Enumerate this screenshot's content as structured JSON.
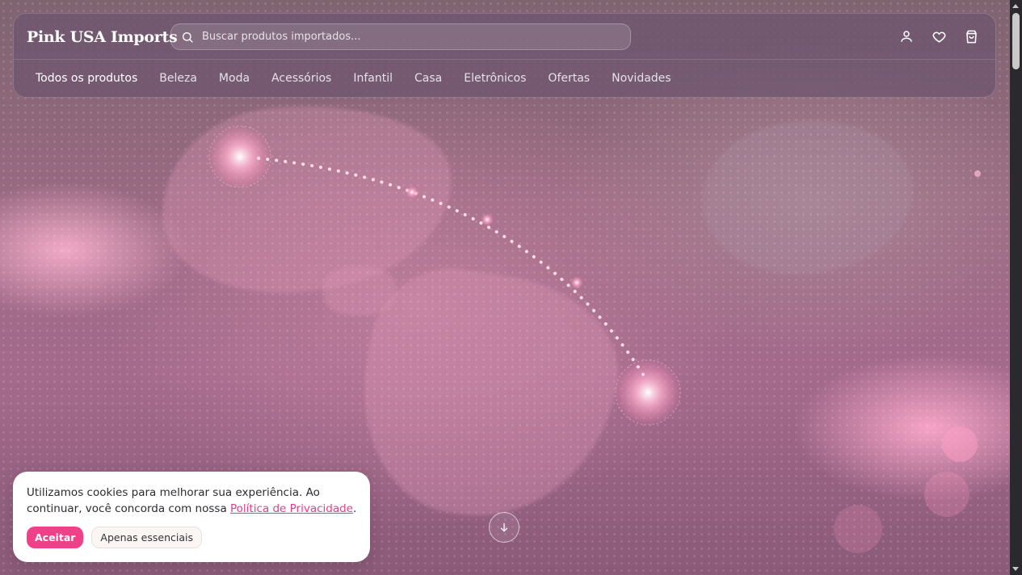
{
  "brand": {
    "name": "Pink USA Imports"
  },
  "search": {
    "placeholder": "Buscar produtos importados..."
  },
  "header_icons": [
    "user-icon",
    "heart-icon",
    "shopping-bag-icon"
  ],
  "nav": {
    "items": [
      {
        "label": "Todos os produtos",
        "active": true
      },
      {
        "label": "Beleza"
      },
      {
        "label": "Moda"
      },
      {
        "label": "Acessórios"
      },
      {
        "label": "Infantil"
      },
      {
        "label": "Casa"
      },
      {
        "label": "Eletrônicos"
      },
      {
        "label": "Ofertas"
      },
      {
        "label": "Novidades"
      }
    ]
  },
  "hero": {
    "scroll_icon": "arrow-down-icon"
  },
  "cookie": {
    "text_before": "Utilizamos cookies para melhorar sua experiência. Ao continuar, você concorda com nossa ",
    "link": "Política de Privacidade",
    "text_after": ".",
    "accept": "Aceitar",
    "essential": "Apenas essenciais"
  },
  "colors": {
    "accent": "#f0408a",
    "link": "#e0408a"
  }
}
